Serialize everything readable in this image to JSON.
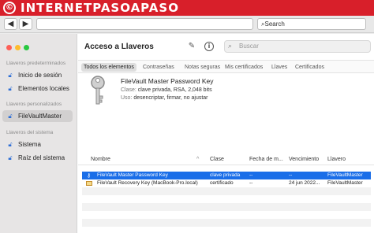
{
  "banner": {
    "logo": "©",
    "text": "INTERNETPASOAPASO"
  },
  "browser": {
    "back_label": "◀",
    "forward_label": "▶",
    "search_text": "Search"
  },
  "window": {
    "title": "Acceso a Llaveros",
    "toolbar_icons": [
      "compose-icon",
      "info-icon"
    ],
    "search_placeholder": "Buscar"
  },
  "sidebar": {
    "sections": [
      {
        "title": "Llaveros predeterminados",
        "items": [
          {
            "label": "Inicio de sesión",
            "icon": "lock-icon",
            "selected": false
          },
          {
            "label": "Elementos locales",
            "icon": "lock-icon",
            "selected": false
          }
        ]
      },
      {
        "title": "Llaveros personalizados",
        "items": [
          {
            "label": "FileVaultMaster",
            "icon": "lock-icon",
            "selected": true
          }
        ]
      },
      {
        "title": "Llaveros del sistema",
        "items": [
          {
            "label": "Sistema",
            "icon": "lock-icon",
            "selected": false
          },
          {
            "label": "Raíz del sistema",
            "icon": "lock-icon",
            "selected": false
          }
        ]
      }
    ]
  },
  "tabs": [
    "Todos los elementos",
    "Contraseñas",
    "Notas seguras",
    "Mis certificados",
    "Llaves",
    "Certificados"
  ],
  "selected_tab": "Todos los elementos",
  "detail": {
    "name": "FileVault Master Password Key",
    "class_label": "Clase:",
    "class_value": "clave privada, RSA, 2,048 bits",
    "use_label": "Uso:",
    "use_value": "desencriptar, firmar, no ajustar"
  },
  "table": {
    "columns": [
      "Nombre",
      "Clase",
      "Fecha de m...",
      "Vencimiento",
      "Llavero"
    ],
    "sort_indicator": "^",
    "rows": [
      {
        "icon": "key-icon",
        "name": "FileVault Master Password Key",
        "clase": "clave privada",
        "fecha": "--",
        "vencimiento": "--",
        "llavero": "FileVaultMaster",
        "selected": true
      },
      {
        "icon": "certificate-icon",
        "name": "FileVault Recovery Key (MacBook-Pro.local)",
        "clase": "certificado",
        "fecha": "--",
        "vencimiento": "24 jun 2022...",
        "llavero": "FileVaultMaster",
        "selected": false
      }
    ]
  }
}
